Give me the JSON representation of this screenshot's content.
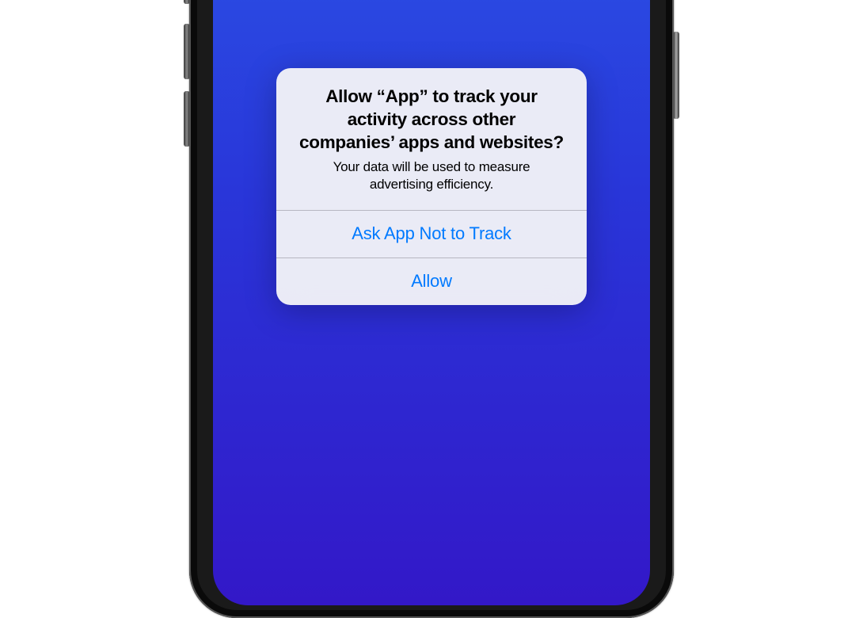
{
  "alert": {
    "title": "Allow “App” to track your activity across other companies’ apps and websites?",
    "message": "Your data will be used to measure advertising efficiency.",
    "deny_label": "Ask App Not to Track",
    "allow_label": "Allow"
  }
}
